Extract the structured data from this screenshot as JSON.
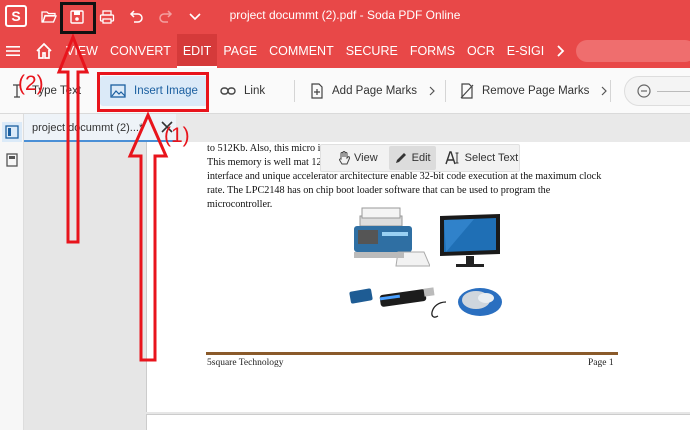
{
  "window": {
    "title": "project docummt (2).pdf - Soda PDF Online",
    "logo": "S"
  },
  "titlebar_icons": [
    "folder-open-icon",
    "save-icon",
    "print-icon",
    "undo-icon",
    "redo-icon",
    "chevron-down-icon"
  ],
  "menu": {
    "tabs": [
      {
        "id": "view",
        "label": "VIEW"
      },
      {
        "id": "convert",
        "label": "CONVERT"
      },
      {
        "id": "edit",
        "label": "EDIT",
        "active": true
      },
      {
        "id": "page",
        "label": "PAGE"
      },
      {
        "id": "comment",
        "label": "COMMENT"
      },
      {
        "id": "secure",
        "label": "SECURE"
      },
      {
        "id": "forms",
        "label": "FORMS"
      },
      {
        "id": "ocr",
        "label": "OCR"
      },
      {
        "id": "esign",
        "label": "E-SIGI"
      }
    ]
  },
  "toolbar": {
    "type_text": "Type Text",
    "insert_image": "Insert Image",
    "link": "Link",
    "add_page_marks": "Add Page Marks",
    "remove_page_marks": "Remove Page Marks"
  },
  "doc_tab": {
    "name": "project docummt (2)...",
    "modified": "*"
  },
  "mode_bar": {
    "view": "View",
    "edit": "Edit",
    "select_text": "Select Text"
  },
  "document": {
    "lines": [
      "to 512Kb. Also, this micro                                                   inish point USB RAM.",
      "This memory is well mat                                                   128-bit wide memory",
      "interface and unique accelerator architecture enable 32-bit code execution at the maximum clock",
      "rate.  The  LPC2148  has  on  chip  boot  loader  software  that  can  be  used  to  program  the",
      "microcontroller."
    ],
    "footer_left": "5square Technology",
    "footer_right": "Page 1"
  },
  "annotations": {
    "label_1": "(1)",
    "label_2": "(2)",
    "color": "#e8141c"
  },
  "colors": {
    "brand": "#e84848",
    "accent": "#4a8fd6"
  }
}
